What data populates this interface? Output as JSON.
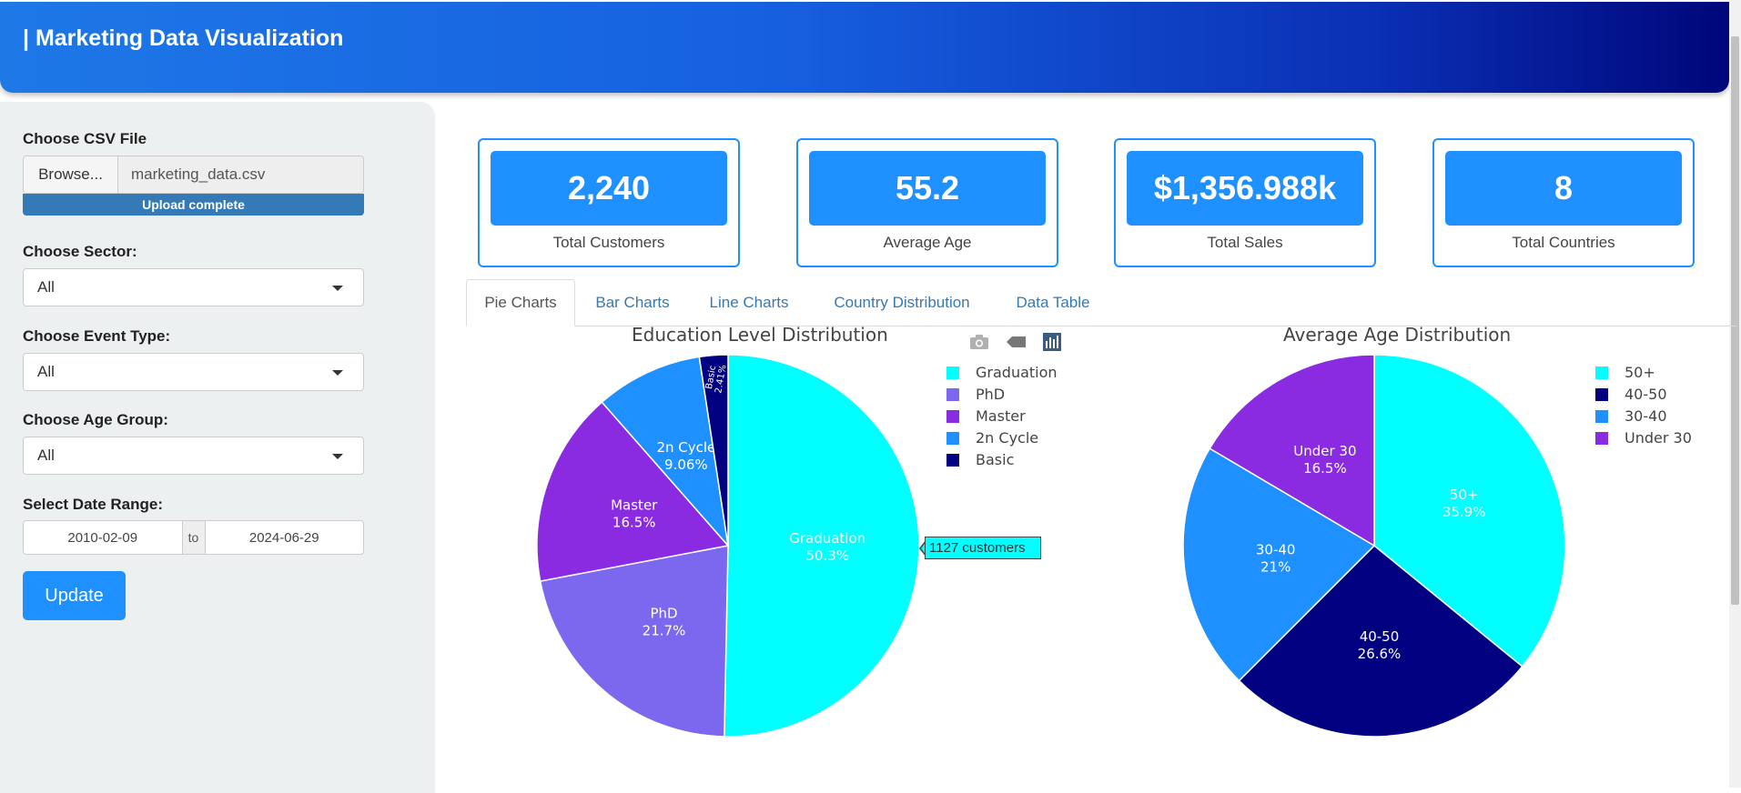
{
  "header": {
    "title": "| Marketing Data Visualization"
  },
  "sidebar": {
    "csv_label": "Choose CSV File",
    "browse_label": "Browse...",
    "file_name": "marketing_data.csv",
    "upload_status": "Upload complete",
    "sector_label": "Choose Sector:",
    "sector_value": "All",
    "event_label": "Choose Event Type:",
    "event_value": "All",
    "age_label": "Choose Age Group:",
    "age_value": "All",
    "date_label": "Select Date Range:",
    "date_start": "2010-02-09",
    "date_sep": "to",
    "date_end": "2024-06-29",
    "update_label": "Update"
  },
  "kpis": [
    {
      "value": "2,240",
      "label": "Total Customers"
    },
    {
      "value": "55.2",
      "label": "Average Age"
    },
    {
      "value": "$1,356.988k",
      "label": "Total Sales"
    },
    {
      "value": "8",
      "label": "Total Countries"
    }
  ],
  "tabs": [
    {
      "label": "Pie Charts",
      "active": true
    },
    {
      "label": "Bar Charts",
      "active": false
    },
    {
      "label": "Line Charts",
      "active": false
    },
    {
      "label": "Country Distribution",
      "active": false
    },
    {
      "label": "Data Table",
      "active": false
    }
  ],
  "modebar": {
    "icons": [
      "camera-icon",
      "tag-icon",
      "bar-chart-icon"
    ]
  },
  "tooltip": {
    "text": "1127  customers",
    "color": "#00ffff"
  },
  "chart_data": [
    {
      "type": "pie",
      "title": "Education Level Distribution",
      "labels": [
        "Graduation",
        "PhD",
        "Master",
        "2n Cycle",
        "Basic"
      ],
      "values": [
        50.3,
        21.7,
        16.5,
        9.06,
        2.41
      ],
      "value_labels": [
        "50.3%",
        "21.7%",
        "16.5%",
        "9.06%",
        "2.41%"
      ],
      "colors": [
        "#00ffff",
        "#7b68ee",
        "#8a2be2",
        "#1e90ff",
        "#000080"
      ],
      "legend": "right"
    },
    {
      "type": "pie",
      "title": "Average Age Distribution",
      "labels": [
        "50+",
        "40-50",
        "30-40",
        "Under 30"
      ],
      "values": [
        35.9,
        26.6,
        21,
        16.5
      ],
      "value_labels": [
        "35.9%",
        "26.6%",
        "21%",
        "16.5%"
      ],
      "colors": [
        "#00ffff",
        "#000080",
        "#1e90ff",
        "#8a2be2"
      ],
      "legend": "right"
    }
  ]
}
